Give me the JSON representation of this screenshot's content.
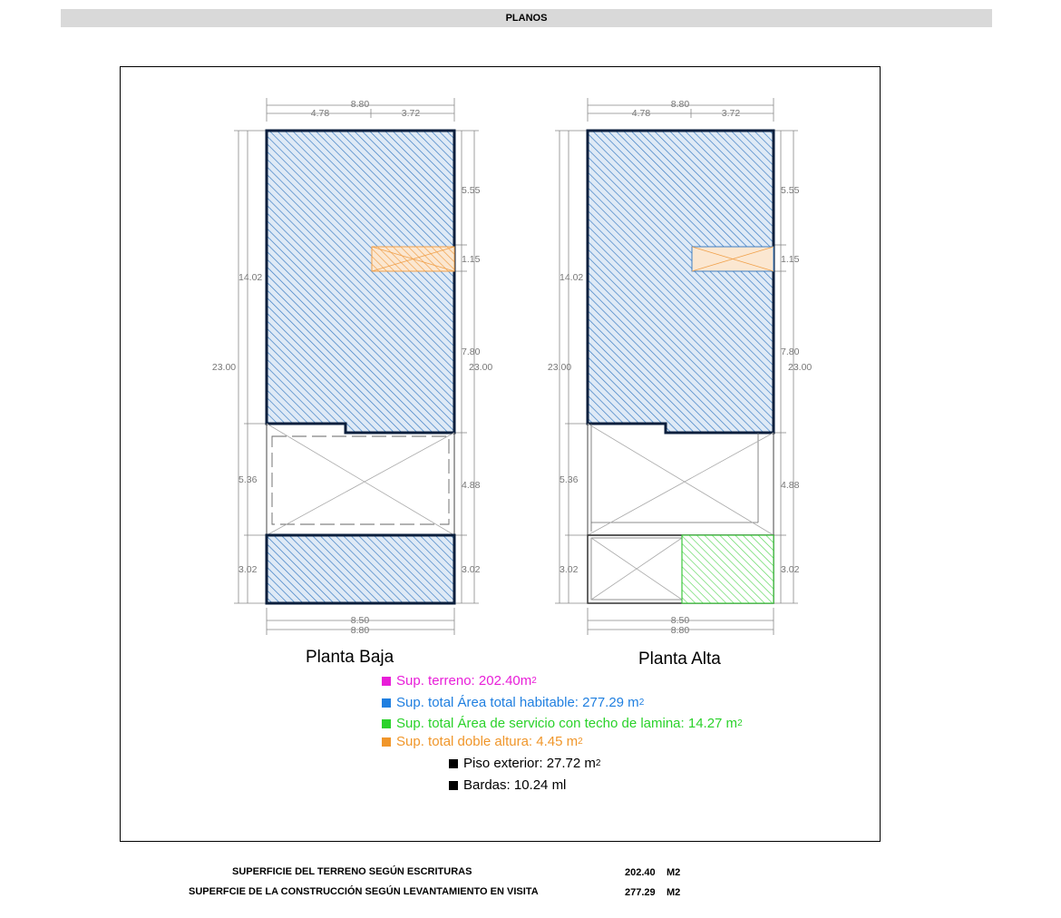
{
  "header": {
    "title": "PLANOS"
  },
  "plans": {
    "ground": {
      "title": "Planta Baja",
      "dims": {
        "top_total": "8.80",
        "top_left": "4.78",
        "top_right": "3.72",
        "right_upper": "5.55",
        "right_mid": "1.15",
        "right_lower": "7.80",
        "right_total": "23.00",
        "left_total": "23.00",
        "left_upper": "14.02",
        "left_mid": "5.36",
        "left_bottom": "3.02",
        "right_yard": "4.88",
        "right_bottom": "3.02",
        "bottom_inner": "8.50",
        "bottom_total": "8.80"
      }
    },
    "upper": {
      "title": "Planta Alta",
      "dims": {
        "top_total": "8.80",
        "top_left": "4.78",
        "top_right": "3.72",
        "right_upper": "5.55",
        "right_mid": "1.15",
        "right_lower": "7.80",
        "right_total": "23.00",
        "left_total": "23.00",
        "left_upper": "14.02",
        "left_mid": "5.36",
        "left_bottom": "3.02",
        "right_yard": "4.88",
        "right_bottom": "3.02",
        "bottom_inner": "8.50",
        "bottom_total": "8.80"
      }
    }
  },
  "legend": {
    "terreno": {
      "text": "Sup. terreno: 202.40m",
      "sup": "2",
      "color": "#e81ed8"
    },
    "habitable": {
      "text": "Sup. total Área total habitable: 277.29 m",
      "sup": "2",
      "color": "#1f7fe0"
    },
    "servicio": {
      "text": "Sup. total Área de servicio con techo de lamina: 14.27 m",
      "sup": "2",
      "color": "#2ad22a"
    },
    "doble": {
      "text": "Sup. total doble altura: 4.45 m",
      "sup": "2",
      "color": "#f0962a"
    },
    "piso": {
      "text": "Piso exterior: 27.72 m",
      "sup": "2",
      "color": "#000000"
    },
    "bardas": {
      "text": "Bardas: 10.24 ml",
      "color": "#000000"
    }
  },
  "summary": {
    "row1": {
      "label": "SUPERFICIE DEL TERRENO SEGÚN  ESCRITURAS",
      "value": "202.40",
      "unit": "M2"
    },
    "row2": {
      "label": "SUPERFCIE DE LA CONSTRUCCIÓN SEGÚN  LEVANTAMIENTO EN VISITA",
      "value": "277.29",
      "unit": "M2"
    }
  }
}
